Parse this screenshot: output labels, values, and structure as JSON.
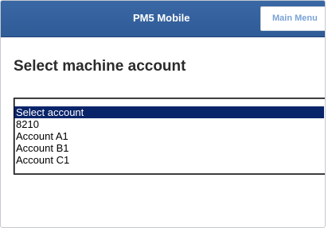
{
  "header": {
    "title": "PM5 Mobile",
    "menu_button_label": "Main Menu"
  },
  "main": {
    "heading": "Select machine account",
    "account_list": {
      "selected_index": 0,
      "options": [
        "Select account",
        "8210",
        "Account A1",
        "Account B1",
        "Account C1"
      ]
    }
  },
  "colors": {
    "header_bg": "#3a68a4",
    "selection_bg": "#0a246a",
    "menu_text": "#7aa3d6"
  }
}
